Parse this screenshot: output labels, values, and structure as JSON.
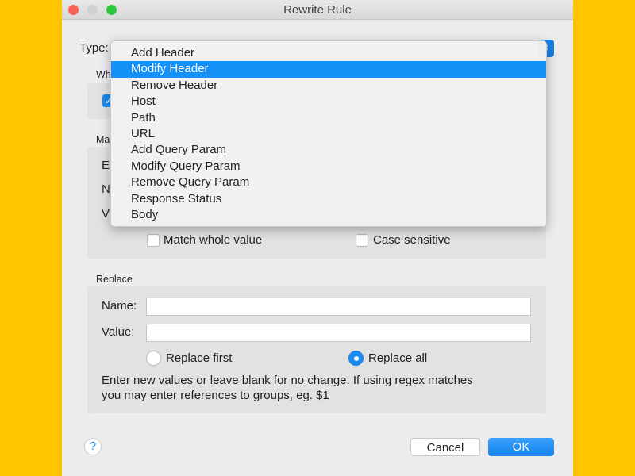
{
  "window": {
    "title": "Rewrite Rule"
  },
  "type": {
    "label": "Type:",
    "options": [
      "Add Header",
      "Modify Header",
      "Remove Header",
      "Host",
      "Path",
      "URL",
      "Add Query Param",
      "Modify Query Param",
      "Remove Query Param",
      "Response Status",
      "Body"
    ],
    "selected": "Modify Header"
  },
  "where": {
    "label_partial": "Wh"
  },
  "match": {
    "label_partial": "Ma",
    "row_labels_partial": [
      "E",
      "N",
      "V"
    ],
    "match_whole_value": {
      "label": "Match whole value",
      "checked": false
    },
    "case_sensitive": {
      "label": "Case sensitive",
      "checked": false
    }
  },
  "replace": {
    "label": "Replace",
    "name_label": "Name:",
    "name_value": "",
    "value_label": "Value:",
    "value_value": "",
    "replace_first": {
      "label": "Replace first",
      "selected": false
    },
    "replace_all": {
      "label": "Replace all",
      "selected": true
    },
    "help_text_1": "Enter new values or leave blank for no change. If using regex matches",
    "help_text_2": "you may enter references to groups, eg. $1"
  },
  "buttons": {
    "help": "?",
    "cancel": "Cancel",
    "ok": "OK"
  },
  "colors": {
    "accent": "#1590f6",
    "background": "#ffc600"
  }
}
